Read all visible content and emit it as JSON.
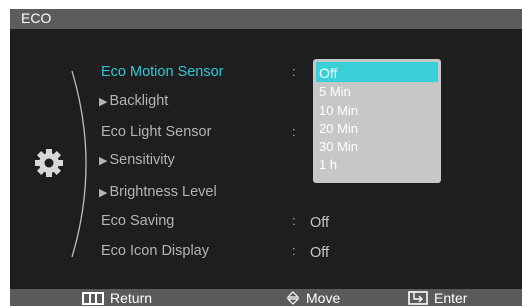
{
  "window": {
    "title": "ECO"
  },
  "sidebar": {
    "icon": "gear-icon"
  },
  "menu": {
    "items": [
      {
        "label": "Eco Motion Sensor",
        "arrow": "",
        "state": "active"
      },
      {
        "label": "Backlight",
        "arrow": "▶",
        "state": "normal"
      },
      {
        "label": "Eco Light Sensor",
        "arrow": "",
        "state": "normal"
      },
      {
        "label": "Sensitivity",
        "arrow": "▶",
        "state": "normal"
      },
      {
        "label": "Brightness Level",
        "arrow": "▶",
        "state": "normal"
      },
      {
        "label": "Eco Saving",
        "arrow": "",
        "state": "normal"
      },
      {
        "label": "Eco Icon Display",
        "arrow": "",
        "state": "normal"
      }
    ],
    "separator": ":",
    "values": {
      "eco_saving": "Off",
      "eco_icon_display": "Off"
    }
  },
  "dropdown": {
    "selected": "Off",
    "options": [
      "Off",
      "5 Min",
      "10 Min",
      "20 Min",
      "30 Min",
      "1 h"
    ]
  },
  "footer": {
    "return_label": "Return",
    "move_label": "Move",
    "enter_label": "Enter"
  },
  "colors": {
    "accent": "#35c7d6",
    "selection": "#39cfd6",
    "panel": "#1e1e1e",
    "bars": "#5c5c5c"
  }
}
